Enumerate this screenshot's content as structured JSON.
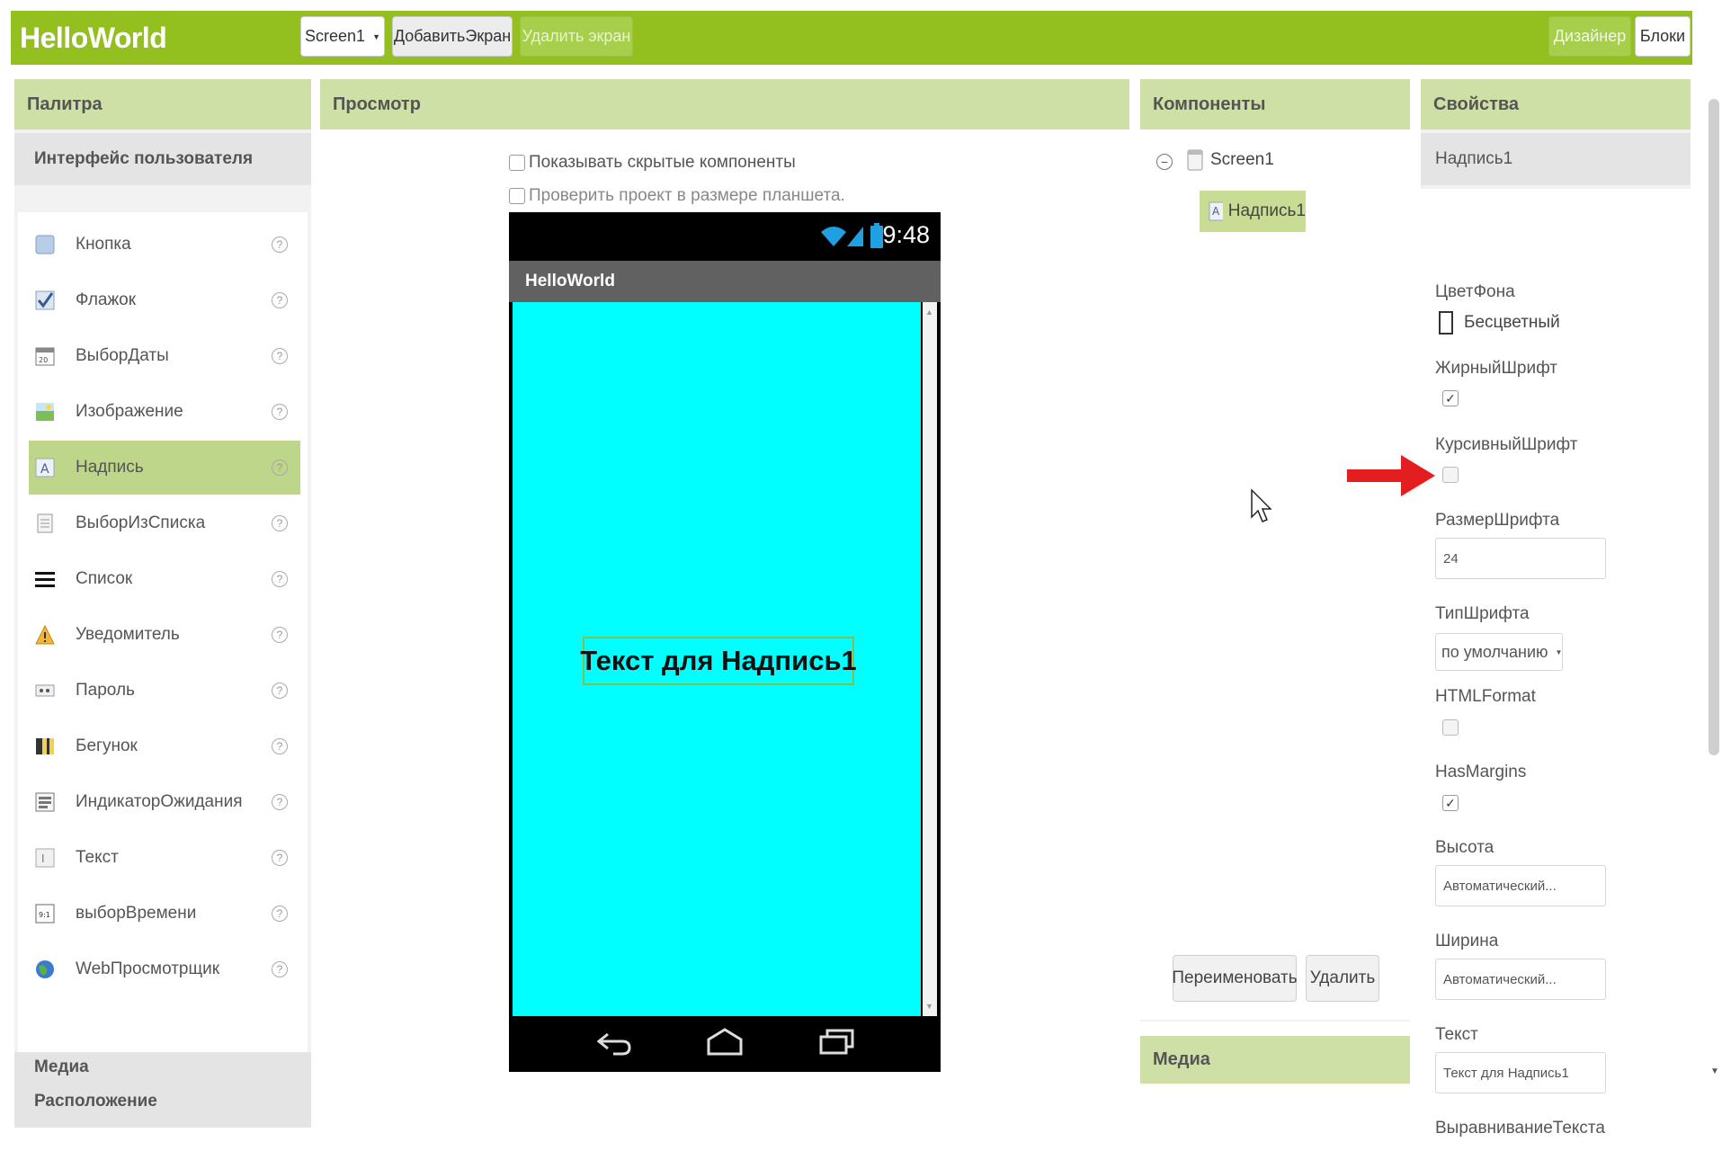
{
  "app": {
    "title": "HelloWorld",
    "accent_color": "#93c01f"
  },
  "toolbar": {
    "screen_select": "Screen1",
    "add_screen": "ДобавитьЭкран",
    "remove_screen": "Удалить экран",
    "designer": "Дизайнер",
    "blocks": "Блоки"
  },
  "palette": {
    "title": "Палитра",
    "section_ui": "Интерфейс пользователя",
    "items": [
      {
        "label": "Кнопка",
        "icon": "button-icon"
      },
      {
        "label": "Флажок",
        "icon": "checkbox-icon"
      },
      {
        "label": "ВыборДаты",
        "icon": "datepicker-icon"
      },
      {
        "label": "Изображение",
        "icon": "image-icon"
      },
      {
        "label": "Надпись",
        "icon": "label-icon",
        "selected": true
      },
      {
        "label": "ВыборИзСписка",
        "icon": "listpicker-icon"
      },
      {
        "label": "Список",
        "icon": "listview-icon"
      },
      {
        "label": "Уведомитель",
        "icon": "notifier-icon"
      },
      {
        "label": "Пароль",
        "icon": "password-icon"
      },
      {
        "label": "Бегунок",
        "icon": "slider-icon"
      },
      {
        "label": "ИндикаторОжидания",
        "icon": "spinner-icon"
      },
      {
        "label": "Текст",
        "icon": "textbox-icon"
      },
      {
        "label": "выборВремени",
        "icon": "timepicker-icon"
      },
      {
        "label": "WebПросмотрщик",
        "icon": "webviewer-icon"
      }
    ],
    "section_layout": "Расположение",
    "section_media": "Медиа"
  },
  "viewer": {
    "title": "Просмотр",
    "show_hidden": "Показывать скрытые компоненты",
    "tablet_size": "Проверить проект в размере планшета.",
    "phone": {
      "clock": "9:48",
      "app_title": "HelloWorld",
      "label_text": "Текст для Надпись1",
      "background_color": "#00ffff"
    }
  },
  "components": {
    "title": "Компоненты",
    "tree": {
      "root": "Screen1",
      "child": "Надпись1"
    },
    "rename": "Переименовать",
    "delete": "Удалить",
    "media_title": "Медиа"
  },
  "properties": {
    "title": "Свойства",
    "component": "Надпись1",
    "bg_color_label": "ЦветФона",
    "bg_color_value": "Бесцветный",
    "bold_label": "ЖирныйШрифт",
    "bold": true,
    "italic_label": "КурсивныйШрифт",
    "italic": false,
    "font_size_label": "РазмерШрифта",
    "font_size_value": "24",
    "font_type_label": "ТипШрифта",
    "font_type_value": "по умолчанию",
    "html_format_label": "HTMLFormat",
    "html_format": false,
    "has_margins_label": "HasMargins",
    "has_margins": true,
    "height_label": "Высота",
    "height_value": "Автоматический...",
    "width_label": "Ширина",
    "width_value": "Автоматический...",
    "text_label": "Текст",
    "text_value": "Текст для Надпись1",
    "text_align_label": "ВыравниваниеТекста"
  },
  "annotation": {
    "arrow_color": "#e41e1e"
  }
}
